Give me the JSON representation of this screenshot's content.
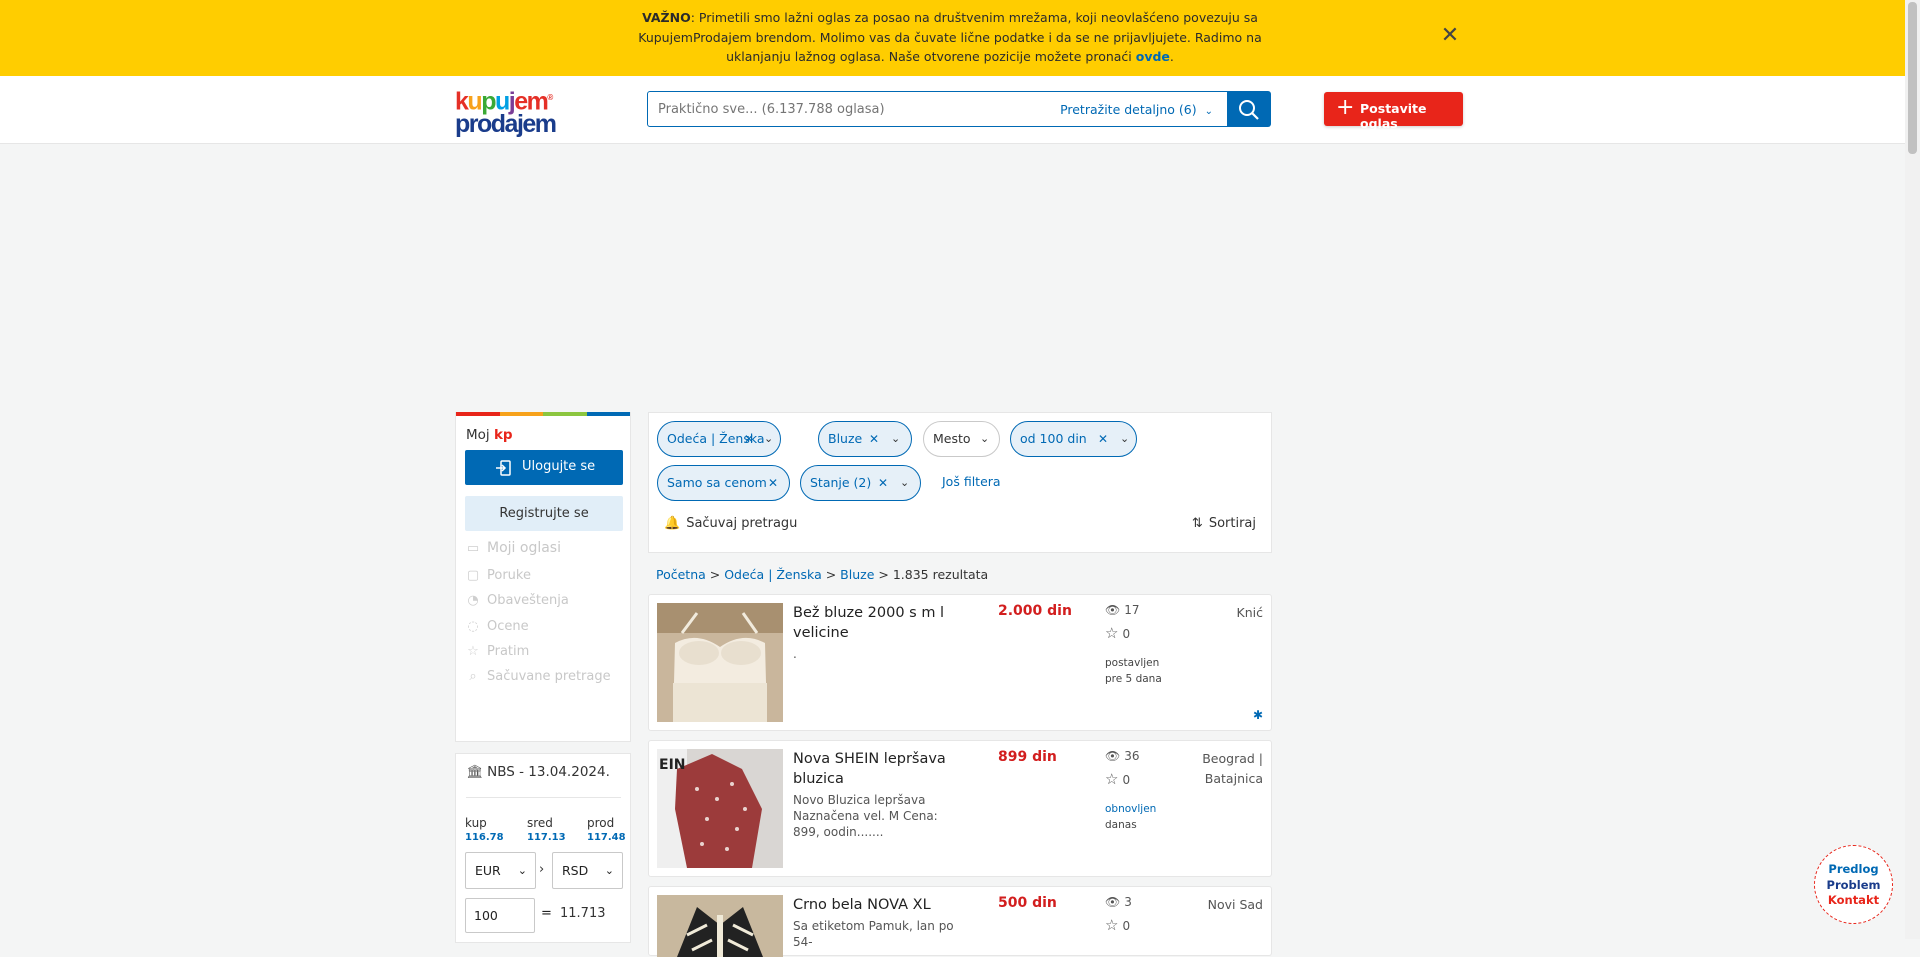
{
  "notice": {
    "bold": "VAŽNO",
    "text": ": Primetili smo lažni oglas za posao na društvenim mrežama, koji neovlašćeno povezuju sa KupujemProdajem brendom. Molimo vas da čuvate lične podatke i da se ne prijavljujete. Radimo na uklanjanju lažnog oglasa. Naše otvorene pozicije možete pronaći ",
    "link": "ovde",
    "tail": ".",
    "close_icon": "close-icon"
  },
  "header": {
    "logo_line1": [
      "k",
      "u",
      "p",
      "u",
      "j",
      "em"
    ],
    "logo_line2": "prodajem",
    "logo_mark": "®",
    "search_placeholder": "Praktično sve... (6.137.788 oglasa)",
    "detail_search": "Pretražite detaljno (6)",
    "post_ad": "Postavite oglas"
  },
  "sidebar": {
    "title_prefix": "Moj ",
    "title_brand": "kp",
    "login": "Ulogujte se",
    "register": "Registrujte se",
    "items": [
      "Moji oglasi",
      "Poruke",
      "Obaveštenja",
      "Ocene",
      "Pratim",
      "Sačuvane pretrage"
    ]
  },
  "nbs": {
    "title": "NBS - 13.04.2024.",
    "labels": [
      "kup",
      "sred",
      "prod"
    ],
    "values": [
      "116.78",
      "117.13",
      "117.48"
    ],
    "from": "EUR",
    "to": "RSD",
    "arrow": "›",
    "amount": "100",
    "eq": "=",
    "result": "11.713"
  },
  "filters": {
    "chips": [
      "Odeća | Ženska",
      "Bluze",
      "Mesto",
      "od 100 din",
      "Samo sa cenom",
      "Stanje (2)"
    ],
    "more": "Još filtera",
    "save": "Sačuvaj pretragu",
    "sort": "Sortiraj"
  },
  "breadcrumb": {
    "items": [
      "Početna",
      "Odeća | Ženska",
      "Bluze"
    ],
    "sep": " > ",
    "count": "1.835 rezultata"
  },
  "listings": [
    {
      "title": "Bež bluze 2000 s m l velicine",
      "desc": ".",
      "price": "2.000 din",
      "views": "17",
      "favs": "0",
      "posted": [
        "postavljen",
        "pre 5 dana"
      ],
      "location": [
        "Knić"
      ]
    },
    {
      "title": "Nova SHEIN lepršava bluzica",
      "desc": "Novo Bluzica lepršava Naznačena vel. M Cena: 899, oodin.......",
      "price": "899 din",
      "views": "36",
      "favs": "0",
      "posted": [
        "obnovljen",
        "danas"
      ],
      "location": [
        "Beograd |",
        "Batajnica"
      ]
    },
    {
      "title": "Crno bela NOVA XL",
      "desc": "Sa etiketom Pamuk, lan po 54-",
      "price": "500 din",
      "views": "3",
      "favs": "0",
      "posted": [
        "",
        ""
      ],
      "location": [
        "Novi Sad"
      ]
    }
  ],
  "feedback": [
    "Predlog",
    "Problem",
    "Kontakt"
  ],
  "colors": {
    "notice_bg": "#ffcd00",
    "brand_blue": "#0069b4",
    "brand_red": "#e8251a",
    "price_red": "#d21e1e"
  }
}
